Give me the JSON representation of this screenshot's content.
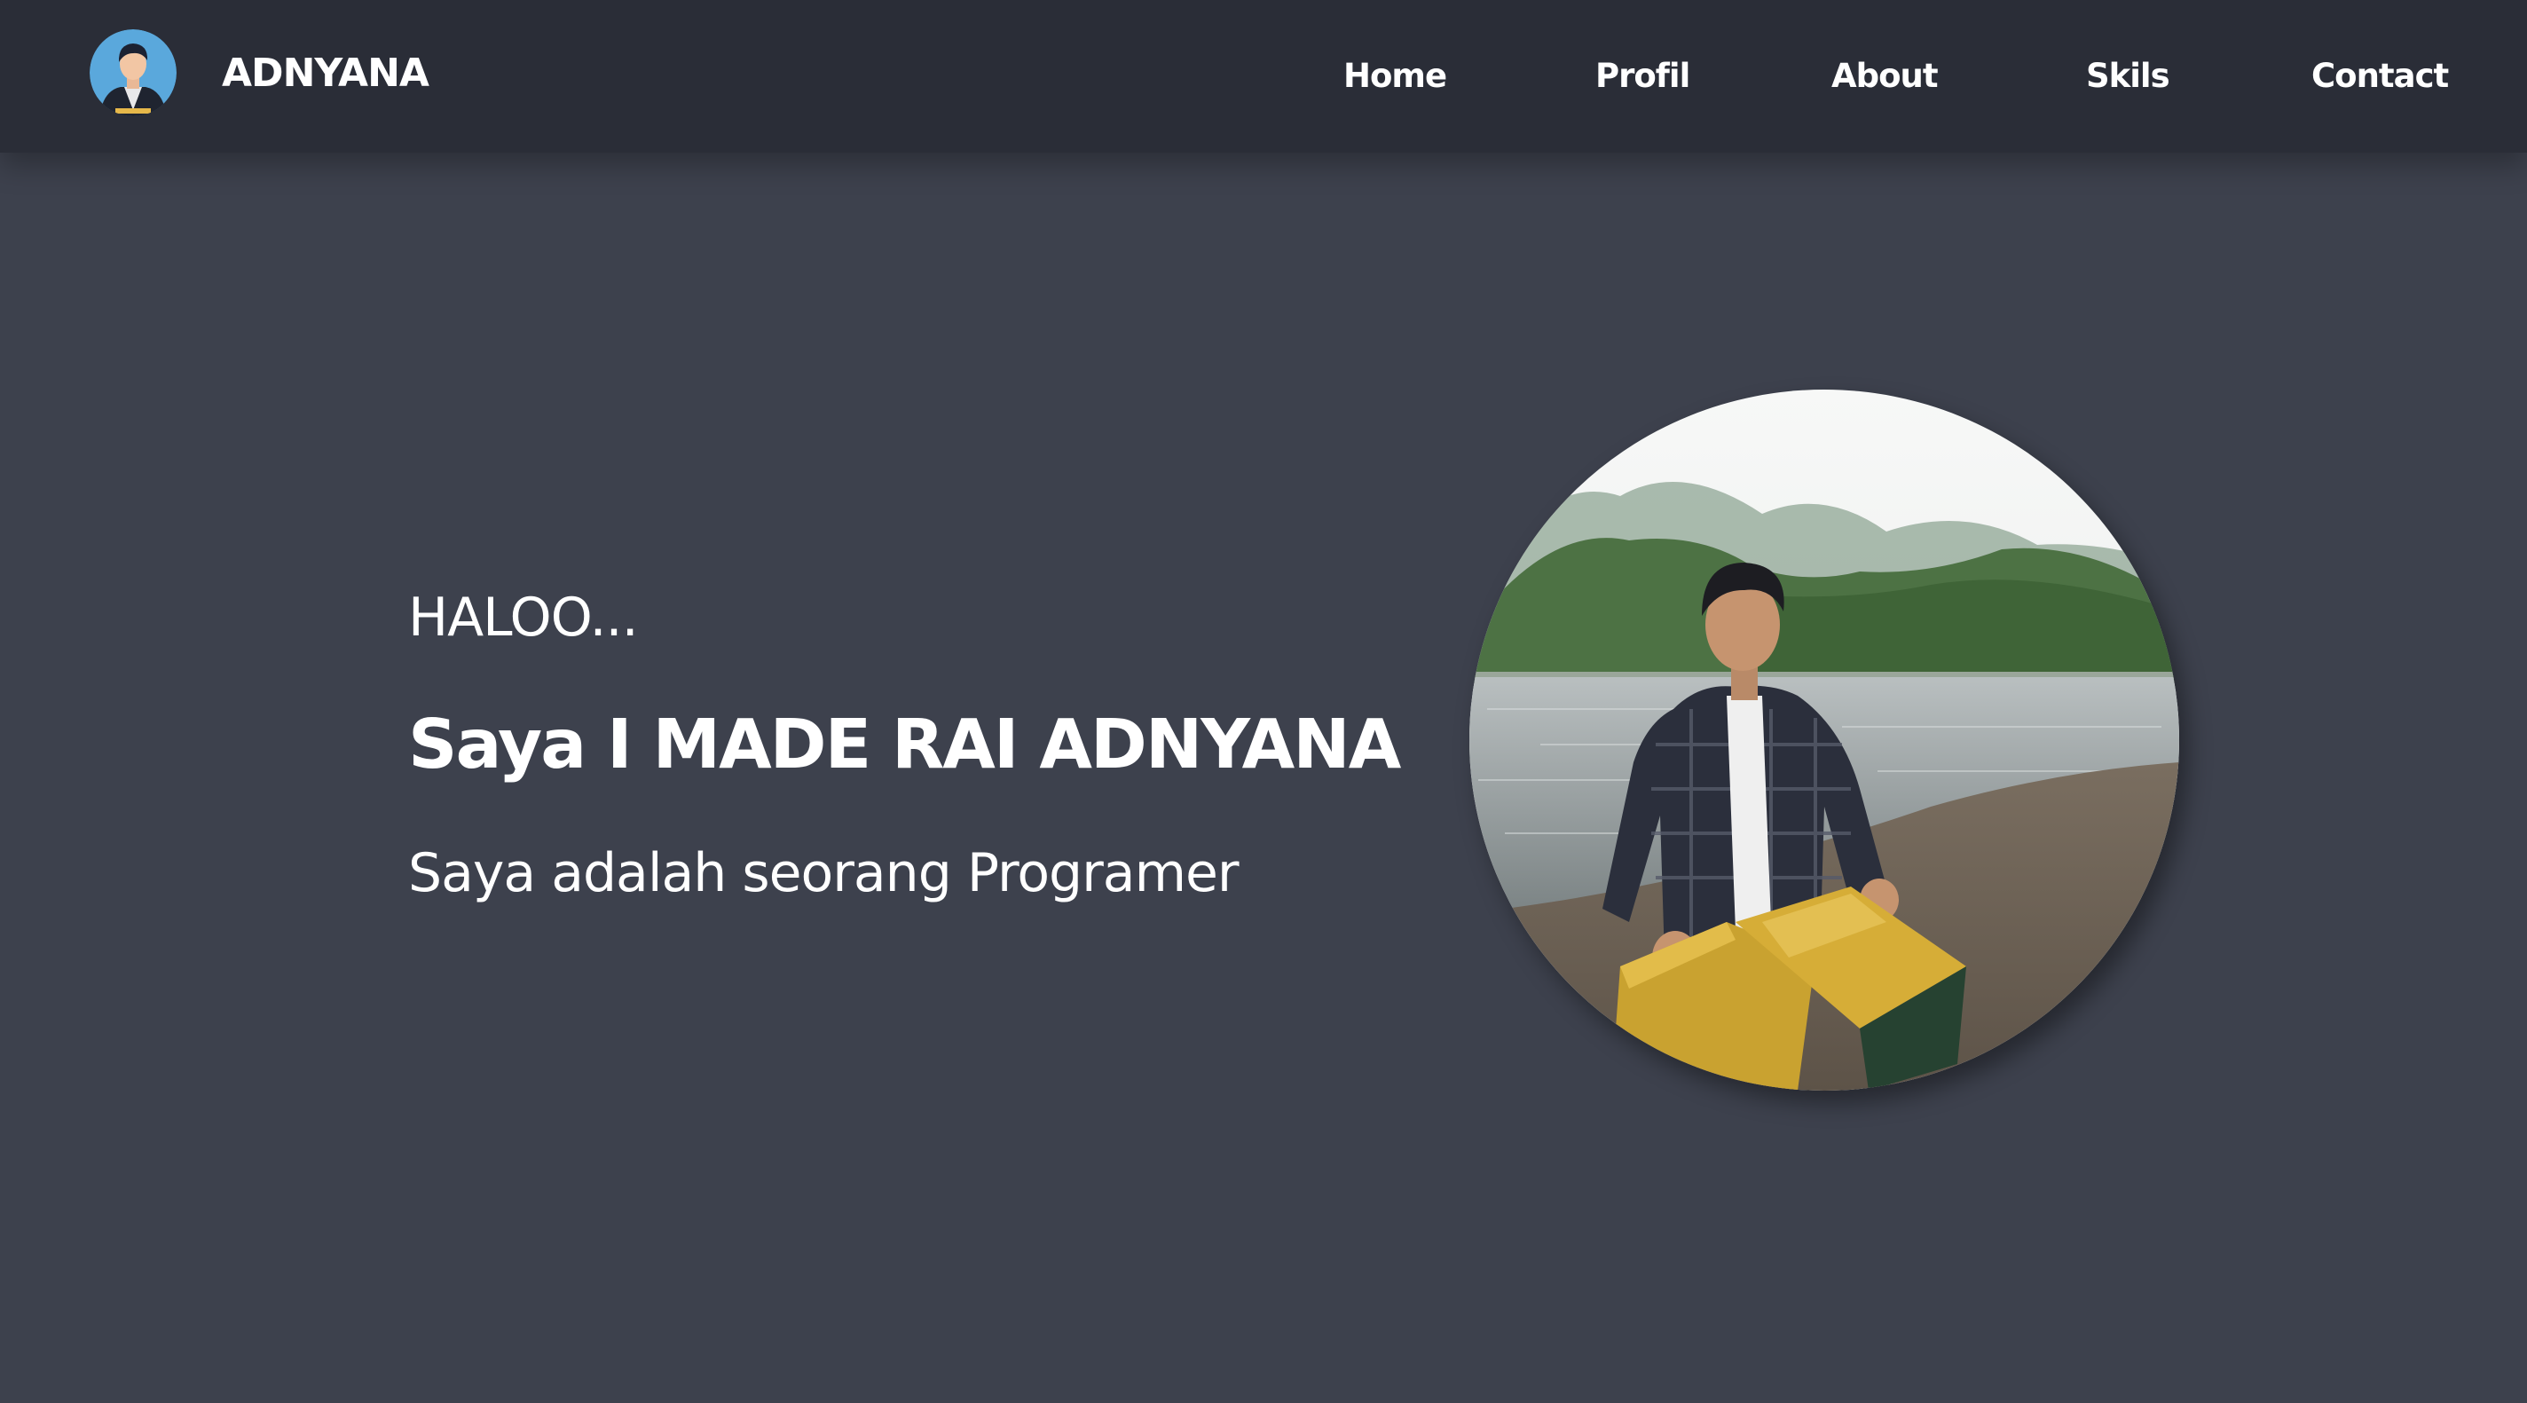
{
  "header": {
    "brand_name": "ADNYANA",
    "nav": [
      {
        "label": "Home"
      },
      {
        "label": "Profil"
      },
      {
        "label": "About"
      },
      {
        "label": "Skils"
      },
      {
        "label": "Contact"
      }
    ]
  },
  "hero": {
    "greeting": "HALOO...",
    "name": "Saya I MADE RAI ADNYANA",
    "role": "Saya adalah seorang Programer"
  },
  "icons": {
    "brand_logo": "avatar-icon",
    "profile_photo": "profile-photo"
  },
  "colors": {
    "navbar_background": "#2a2d37",
    "page_background": "#3d414d",
    "text": "#ffffff"
  }
}
